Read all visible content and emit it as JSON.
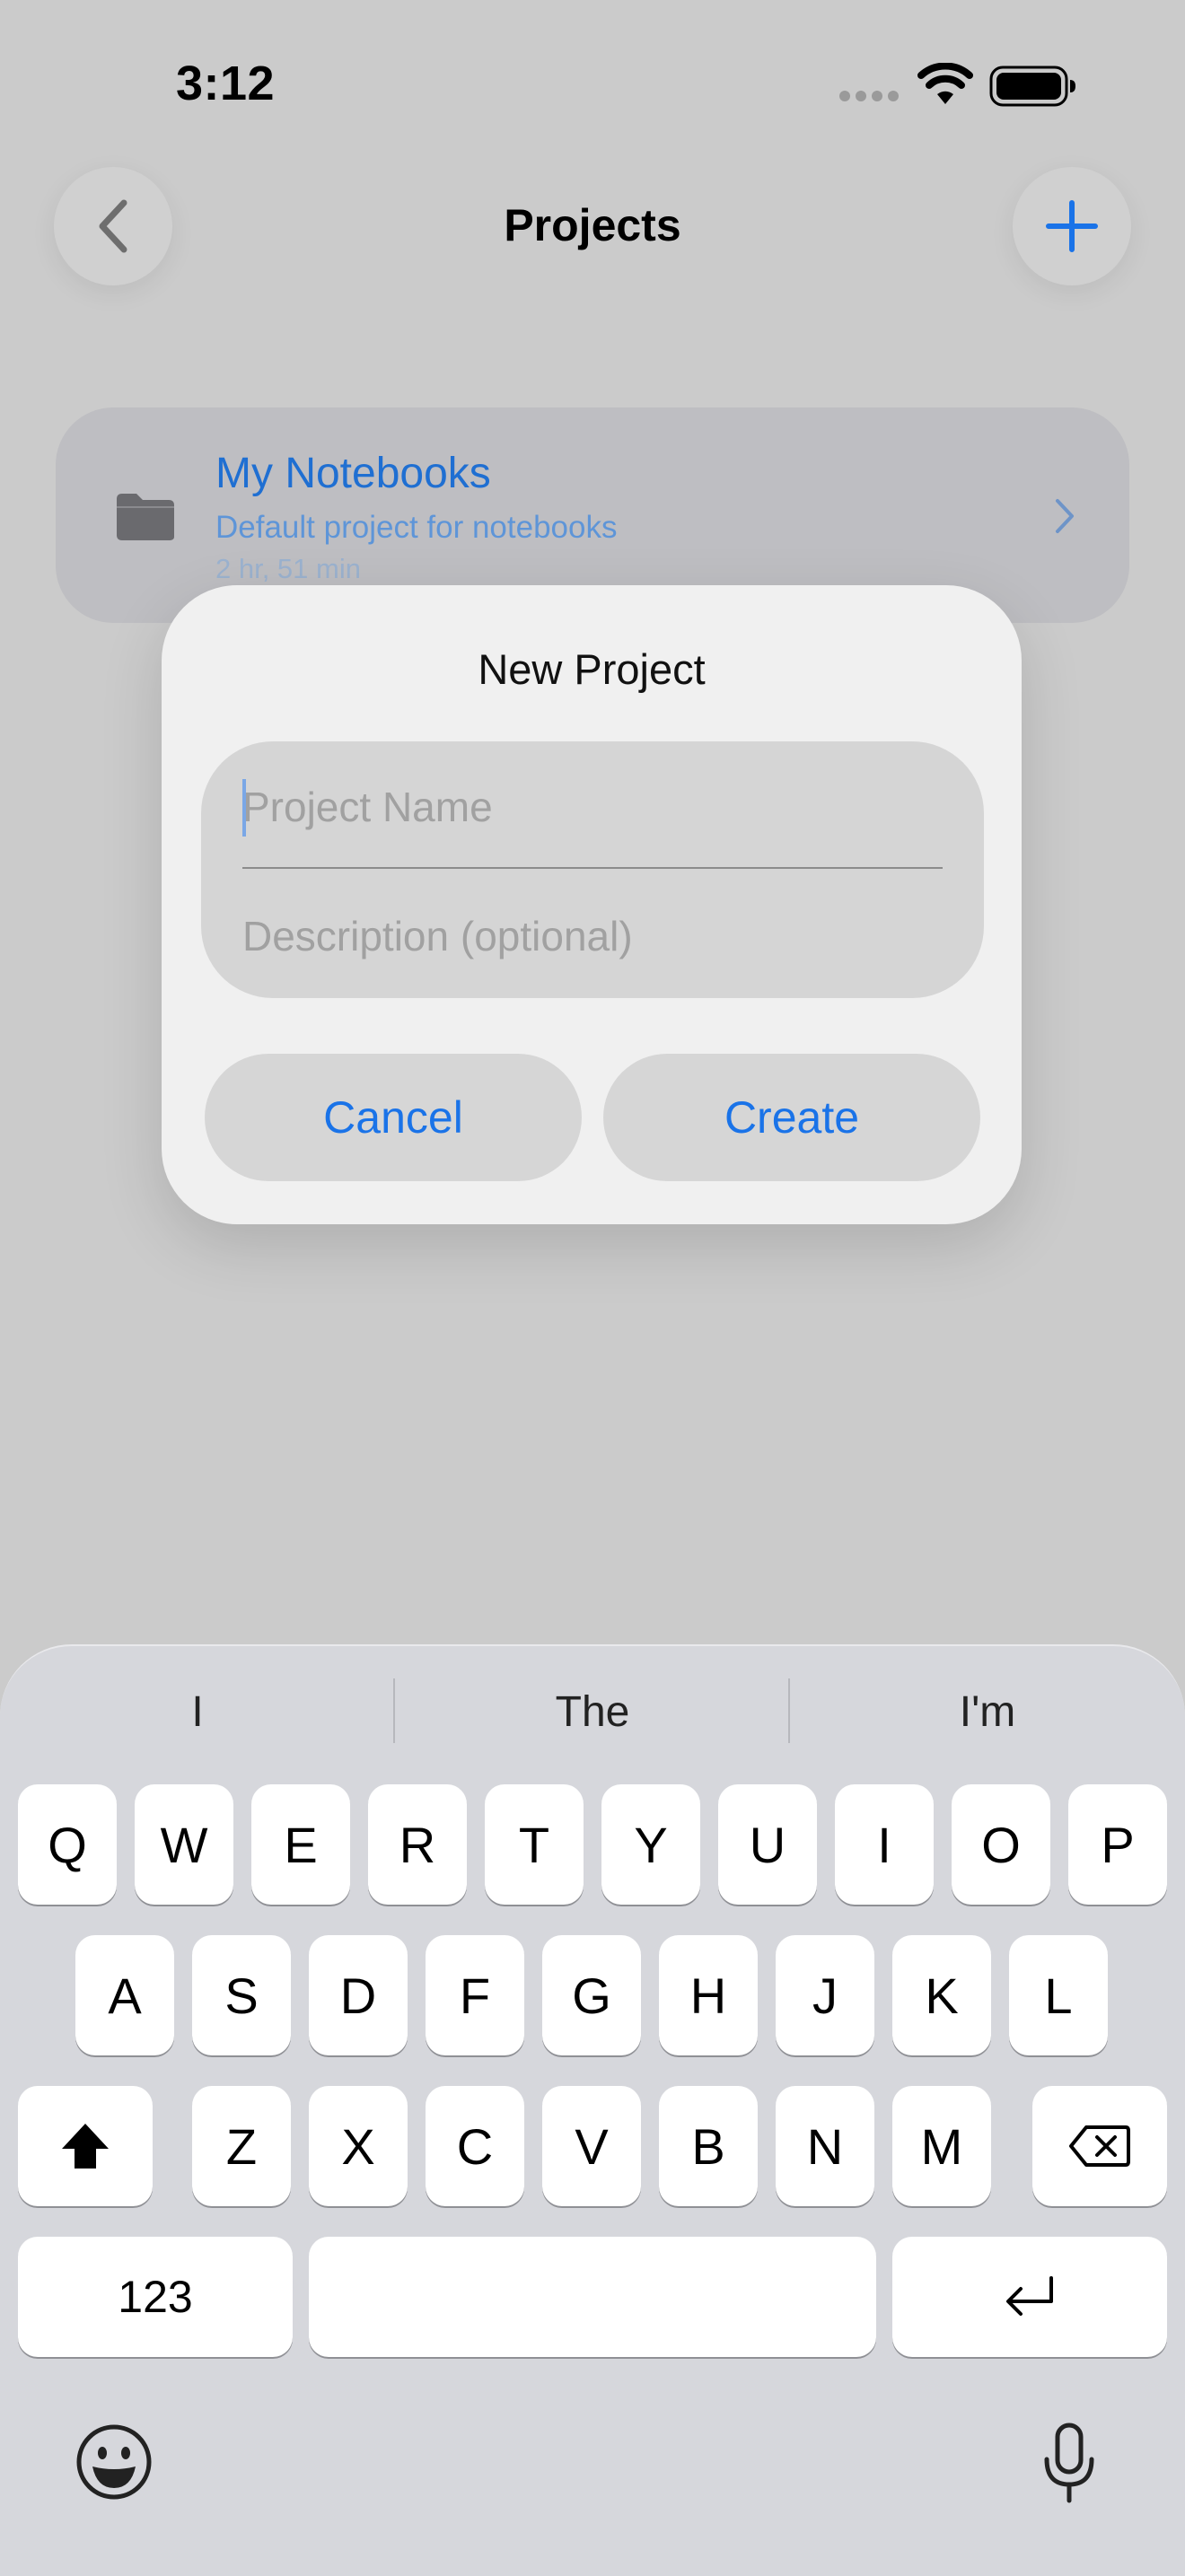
{
  "status_bar": {
    "time": "3:12"
  },
  "nav": {
    "title": "Projects"
  },
  "project": {
    "title": "My Notebooks",
    "description": "Default project for notebooks",
    "time": "2 hr, 51 min"
  },
  "dialog": {
    "title": "New Project",
    "name_placeholder": "Project Name",
    "description_placeholder": "Description (optional)",
    "cancel_label": "Cancel",
    "create_label": "Create"
  },
  "keyboard": {
    "suggestions": [
      "I",
      "The",
      "I'm"
    ],
    "row1": [
      "Q",
      "W",
      "E",
      "R",
      "T",
      "Y",
      "U",
      "I",
      "O",
      "P"
    ],
    "row2": [
      "A",
      "S",
      "D",
      "F",
      "G",
      "H",
      "J",
      "K",
      "L"
    ],
    "row3": [
      "Z",
      "X",
      "C",
      "V",
      "B",
      "N",
      "M"
    ],
    "numbers_label": "123"
  },
  "colors": {
    "accent": "#1a73e8",
    "background": "#cbcbcb",
    "dialog": "#f0f0f0",
    "keyboard": "#d6d7dc"
  },
  "icons": {
    "back": "chevron-left-icon",
    "add": "plus-icon",
    "folder": "folder-icon",
    "chevron": "chevron-right-icon",
    "shift": "shift-icon",
    "delete": "delete-icon",
    "return": "return-icon",
    "emoji": "emoji-icon",
    "mic": "microphone-icon"
  }
}
